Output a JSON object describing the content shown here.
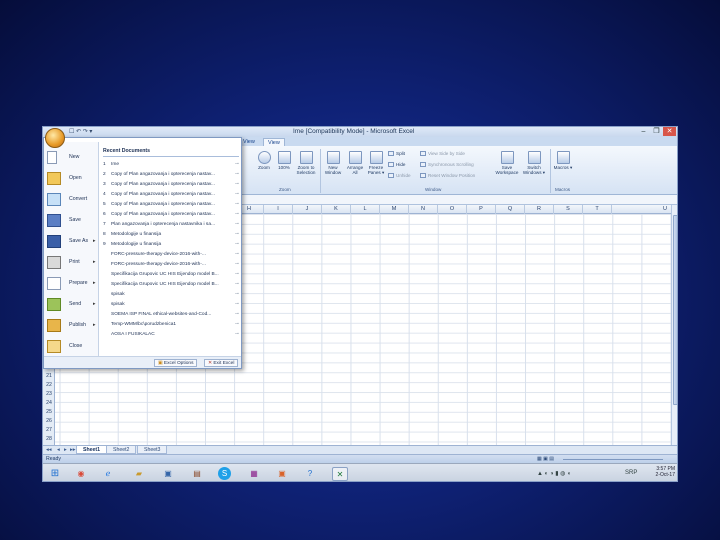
{
  "window": {
    "title": "Ime  [Compatibility Mode] - Microsoft Excel",
    "qat": "☐ ↶ ↷ ▾",
    "controls": [
      "–",
      "❐",
      "✕"
    ]
  },
  "ribbon": {
    "tabs": [
      "View",
      "View"
    ],
    "zoom_group": {
      "label": "Zoom",
      "buttons": [
        "Zoom",
        "100%",
        "Zoom to Selection"
      ]
    },
    "window_group": {
      "label": "Window",
      "buttons": [
        "New Window",
        "Arrange All",
        "Freeze Panes ▾"
      ],
      "split": "Split",
      "hide": "Hide",
      "unhide": "Unhide",
      "side_by_side": "View Side by Side",
      "sync_scroll": "Synchronous Scrolling",
      "reset_pos": "Reset Window Position",
      "save_ws": "Save Workspace",
      "switch": "Switch Windows ▾"
    },
    "macros_group": {
      "label": "Macros",
      "button": "Macros ▾"
    }
  },
  "grid": {
    "columns": [
      "G",
      "H",
      "I",
      "J",
      "K",
      "L",
      "M",
      "N",
      "O",
      "P",
      "Q",
      "R",
      "S",
      "T",
      "U"
    ],
    "row_labels": [
      "20",
      "21",
      "22",
      "23",
      "24",
      "25",
      "26",
      "27",
      "28",
      "29"
    ]
  },
  "sheets": [
    "Sheet1",
    "Sheet2",
    "Sheet3"
  ],
  "status": {
    "ready": "Ready"
  },
  "tray": {
    "lang": "SRP",
    "time": "3:57 PM",
    "date": "2-Oct-17"
  },
  "office_menu": {
    "items": [
      {
        "label": "New",
        "arrow": ""
      },
      {
        "label": "Open",
        "arrow": ""
      },
      {
        "label": "Convert",
        "arrow": ""
      },
      {
        "label": "Save",
        "arrow": ""
      },
      {
        "label": "Save As",
        "arrow": "▸"
      },
      {
        "label": "Print",
        "arrow": "▸"
      },
      {
        "label": "Prepare",
        "arrow": "▸"
      },
      {
        "label": "Send",
        "arrow": "▸"
      },
      {
        "label": "Publish",
        "arrow": "▸"
      },
      {
        "label": "Close",
        "arrow": ""
      }
    ],
    "recent_heading": "Recent Documents",
    "recent": [
      {
        "num": "1",
        "name": "Ime"
      },
      {
        "num": "2",
        "name": "Copy of Plan angazovanja i opterecenja nastav..."
      },
      {
        "num": "3",
        "name": "Copy of Plan angazovanja i opterecenja nastav..."
      },
      {
        "num": "4",
        "name": "Copy of Plan angazovanja i opterecenja nastav..."
      },
      {
        "num": "5",
        "name": "Copy of Plan angazovanja i opterecenja nastav..."
      },
      {
        "num": "6",
        "name": "Copy of Plan angazovanja i opterecenja nastav..."
      },
      {
        "num": "7",
        "name": "Plan angazovanja i opterecenja nastavnika i sa..."
      },
      {
        "num": "8",
        "name": "Metodologije u finansija"
      },
      {
        "num": "9",
        "name": "Metodologije u finansija"
      },
      {
        "num": "",
        "name": "FORC-pressure-therapy-device-2016-with-..."
      },
      {
        "num": "",
        "name": "FORC-pressure-therapy-device-2016-with-..."
      },
      {
        "num": "",
        "name": "Specifikacija Grupovic UC HIS Eijendop model B..."
      },
      {
        "num": "",
        "name": "Specifikacija Grupovic UC HIS Eijendop model B..."
      },
      {
        "num": "",
        "name": "spisak"
      },
      {
        "num": "",
        "name": "spisak"
      },
      {
        "num": "",
        "name": "SOEMA ISP FINAL ethical-websites-and-Cod..."
      },
      {
        "num": "",
        "name": "Temp-WMM\\bc\\porudzbenica1"
      },
      {
        "num": "",
        "name": "AOSA I FUSIKALAC"
      }
    ],
    "excel_options": "Excel Options",
    "exit_excel": "Exit Excel"
  }
}
